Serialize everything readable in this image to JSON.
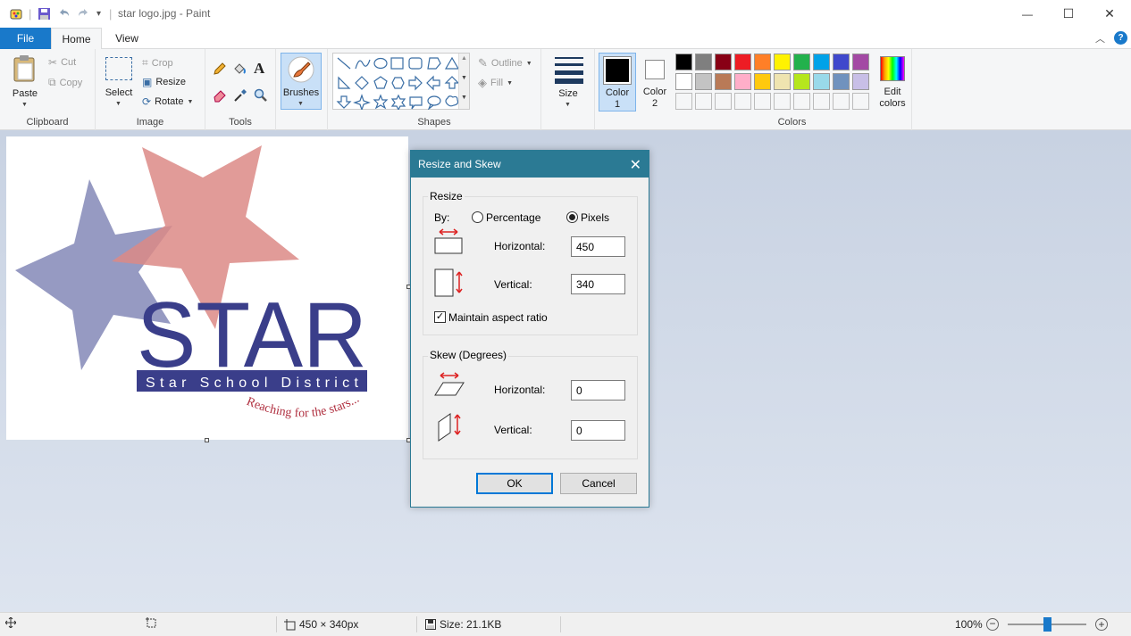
{
  "window": {
    "title": "star logo.jpg - Paint",
    "minimize": "—",
    "maximize": "☐",
    "close": "✕"
  },
  "menu": {
    "file": "File",
    "tabs": [
      "Home",
      "View"
    ]
  },
  "ribbon": {
    "clipboard": {
      "label": "Clipboard",
      "paste": "Paste",
      "cut": "Cut",
      "copy": "Copy"
    },
    "image": {
      "label": "Image",
      "select": "Select",
      "crop": "Crop",
      "resize": "Resize",
      "rotate": "Rotate"
    },
    "tools": {
      "label": "Tools"
    },
    "brushes": "Brushes",
    "shapes": {
      "label": "Shapes",
      "outline": "Outline",
      "fill": "Fill"
    },
    "size": "Size",
    "color1": {
      "label": "Color",
      "num": "1",
      "color": "#000000"
    },
    "color2": {
      "label": "Color",
      "num": "2",
      "color": "#ffffff"
    },
    "colors": {
      "label": "Colors",
      "row1": [
        "#000000",
        "#7f7f7f",
        "#880015",
        "#ed1c24",
        "#ff7f27",
        "#fff200",
        "#22b14c",
        "#00a2e8",
        "#3f48cc",
        "#a349a4"
      ],
      "row2": [
        "#ffffff",
        "#c3c3c3",
        "#b97a57",
        "#ffaec9",
        "#ffc90e",
        "#efe4b0",
        "#b5e61d",
        "#99d9ea",
        "#7092be",
        "#c8bfe7"
      ]
    },
    "edit_colors": {
      "line1": "Edit",
      "line2": "colors"
    }
  },
  "canvas_image": {
    "brand": "STAR",
    "subtitle": "Star School District",
    "tagline": "Reaching for the stars..."
  },
  "dialog": {
    "title": "Resize and Skew",
    "resize_legend": "Resize",
    "by_label": "By:",
    "percentage": "Percentage",
    "pixels": "Pixels",
    "selected_mode": "Pixels",
    "horizontal_label": "Horizontal:",
    "vertical_label": "Vertical:",
    "resize_horizontal": "450",
    "resize_vertical": "340",
    "maintain_aspect": "Maintain aspect ratio",
    "maintain_checked": true,
    "skew_legend": "Skew (Degrees)",
    "skew_horizontal": "0",
    "skew_vertical": "0",
    "ok": "OK",
    "cancel": "Cancel"
  },
  "status": {
    "dimensions": "450 × 340px",
    "size": "Size: 21.1KB",
    "zoom": "100%",
    "zoom_level": 1.0
  }
}
